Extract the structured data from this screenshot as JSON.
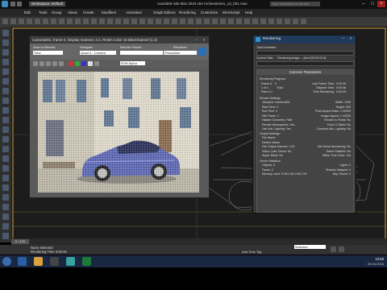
{
  "titlebar": {
    "workspace": "Workspace: Default",
    "title": "Autodesk 3ds Max 2016 x64    Archexteriors_13_001.max",
    "search_placeholder": "Type a keyword or phrase"
  },
  "menu": [
    "Edit",
    "Tools",
    "Group",
    "Views",
    "Create",
    "Modifiers",
    "Animation",
    "Graph Editors",
    "Rendering",
    "Customize",
    "MAXScript",
    "Help"
  ],
  "render_frame": {
    "title": "Camera001, frame 0, Display Gamma: 2.2, RGBA Color 16 Bits/Channel (1:2)",
    "area_to_render_label": "Area to Render:",
    "area_to_render": "View",
    "viewport_label": "Viewport:",
    "viewport": "Quad 4 - Camera",
    "preset_label": "Render Preset:",
    "preset": "",
    "renderer_label": "Renderer:",
    "renderer": "Production",
    "channel": "RGB Alpha"
  },
  "rendering_dialog": {
    "title": "Rendering",
    "total_animation": "Total Animation:",
    "current_task_label": "Current Task:",
    "current_task": "Rendering image.....(time [00:00:02.8]",
    "common_params_header": "Common Parameters",
    "rendering_progress_label": "Rendering Progress:",
    "frame_label": "Frame #",
    "frame_value": "0",
    "last_frame_time_label": "Last Frame Time:",
    "last_frame_time": "0:00:49",
    "elapsed_time_label": "Elapsed Time:",
    "elapsed_time": "0:00:48",
    "of_label": "1 of 1",
    "total_label": "Total:",
    "time_remaining_label": "Time Remaining:",
    "time_remaining": "0:00:49",
    "pass_label": "Pass # 1",
    "render_settings_header": "Render Settings",
    "rs_left": [
      "Viewport: Camera001",
      "Start Time: 0",
      "End Time: 0",
      "Nth Frame: 1",
      "Hidden Geometry: Hide",
      "Render Atmospheric: Yes",
      "Use Adv. Lighting: Yes"
    ],
    "rs_right": [
      "Width: 1200",
      "Height: 900",
      "Pixel Aspect Ratio: 1.00000",
      "Image Aspect: 1.33333",
      "Render to Fields: No",
      "Force 2-Sided: No",
      "Compute Adv. Lighting: No"
    ],
    "output_settings_header": "Output Settings:",
    "os_left": [
      "File Name:",
      "Device Name:",
      "File Output Gamma: 1.00",
      "Video Color Check: No",
      "Super Black: No"
    ],
    "os_right": [
      "",
      "",
      "Nth Serial Numbering: No",
      "Dither Paletted: No",
      "Dither True Color: Yes"
    ],
    "scene_stats_header": "Scene Statistics:",
    "ss_left": [
      "Objects: 0",
      "Faces: 0",
      "Memory used: P:401.1M V:461.7M"
    ],
    "ss_right": [
      "Lights: 0",
      "Shadow Mapped: 0",
      "Ray Traced: 0"
    ]
  },
  "status": {
    "selection": "None Selected",
    "prompt": "Rendering Time 0:00:49",
    "selected_dropdown": "Selected",
    "add_time_tag": "Add Time Tag",
    "clock": "10:53",
    "date": "09.04.2016"
  },
  "colors": {
    "car_body": "#5b66b0",
    "dialog_titlebar": "#1f3a5a",
    "taskbar": "#1a2740"
  }
}
